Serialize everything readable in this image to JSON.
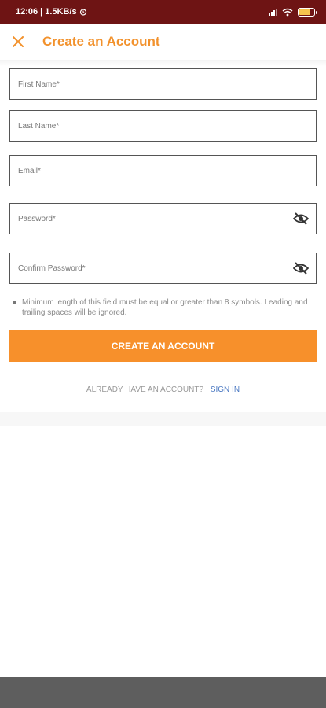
{
  "status_bar": {
    "time": "12:06",
    "network_speed": "1.5KB/s",
    "icons": [
      "signal-icon",
      "wifi-icon",
      "battery-icon"
    ]
  },
  "header": {
    "close_icon": "close-icon",
    "title": "Create an Account"
  },
  "form": {
    "first_name_placeholder": "First Name*",
    "last_name_placeholder": "Last Name*",
    "email_placeholder": "Email*",
    "password_placeholder": "Password*",
    "confirm_password_placeholder": "Confirm Password*",
    "password_hint": "Minimum length of this field must be equal or greater than 8 symbols. Leading and trailing spaces will be ignored.",
    "submit_label": "CREATE AN ACCOUNT",
    "visibility_icon": "eye-off-icon"
  },
  "signin": {
    "question": "ALREADY HAVE AN ACCOUNT?",
    "link": "SIGN IN"
  },
  "colors": {
    "status_bar": "#6e1414",
    "accent": "#f7902b",
    "link": "#4a78c2"
  }
}
